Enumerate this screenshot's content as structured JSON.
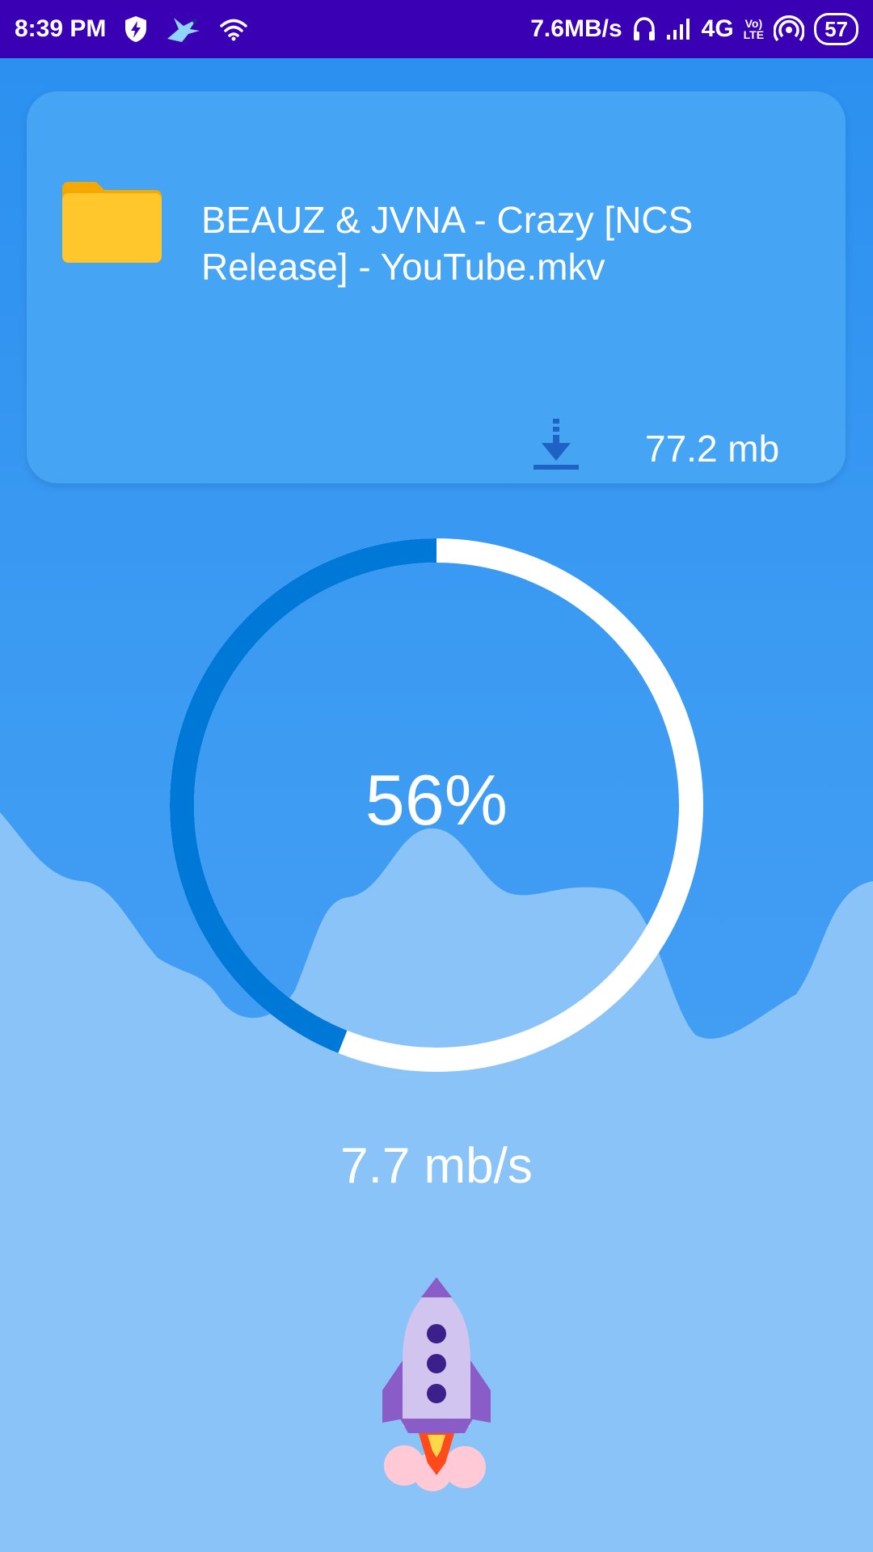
{
  "status_bar": {
    "time": "8:39 PM",
    "network_speed": "7.6MB/s",
    "network_type": "4G",
    "volte_top": "Vo)",
    "volte_bottom": "LTE",
    "battery": "57",
    "icons": [
      "shield-bolt-icon",
      "hummingbird-icon",
      "wifi-icon",
      "headphones-icon",
      "signal-icon",
      "hotspot-icon",
      "battery-icon"
    ]
  },
  "download": {
    "file_name": "BEAUZ & JVNA - Crazy [NCS Release] - YouTube.mkv",
    "file_size": "77.2 mb",
    "progress_percent": 56,
    "progress_label": "56%",
    "speed": "7.7 mb/s"
  },
  "colors": {
    "status_bar": "#3a00b4",
    "background": "#3b9af2",
    "card": "#45a5f4",
    "mountains": "#8ac3f8",
    "progress": "#0078d7",
    "track": "#ffffff",
    "folder": "#ffc72c"
  }
}
